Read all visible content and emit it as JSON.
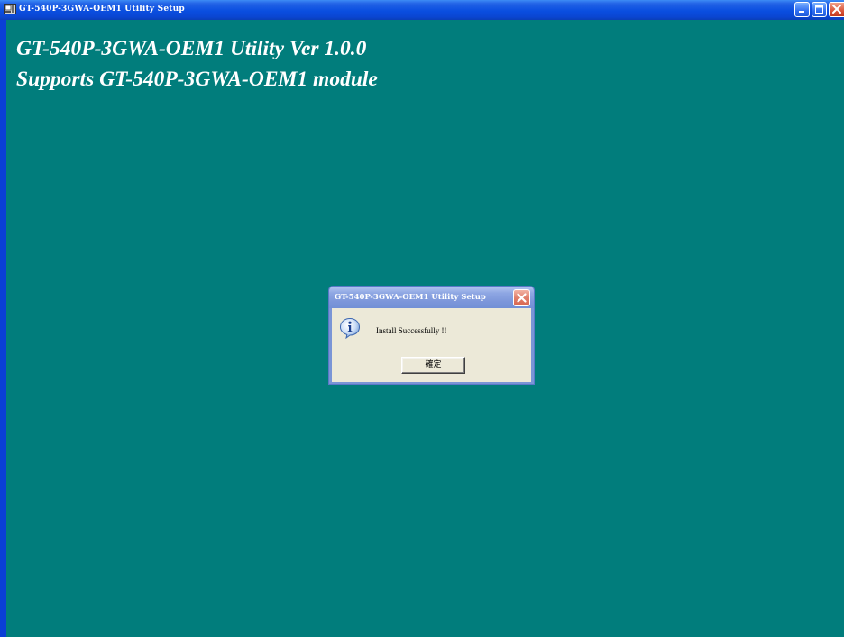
{
  "window": {
    "title": "GT-540P-3GWA-OEM1 Utility Setup",
    "icon": "setup-app-icon",
    "controls": [
      "minimize-icon",
      "maximize-icon",
      "close-icon"
    ]
  },
  "main": {
    "heading_line1": "GT-540P-3GWA-OEM1 Utility Ver 1.0.0",
    "heading_line2": "Supports GT-540P-3GWA-OEM1 module",
    "background_color": "#017d7c"
  },
  "dialog": {
    "title": "GT-540P-3GWA-OEM1 Utility Setup",
    "icon": "info-icon",
    "message": "Install Successfully !!",
    "ok_label": "確定"
  },
  "colors": {
    "titlebar_blue": "#0a4ee0",
    "dialog_titlebar": "#7b96da",
    "dialog_body": "#ece9d8",
    "close_red": "#d9553a"
  }
}
